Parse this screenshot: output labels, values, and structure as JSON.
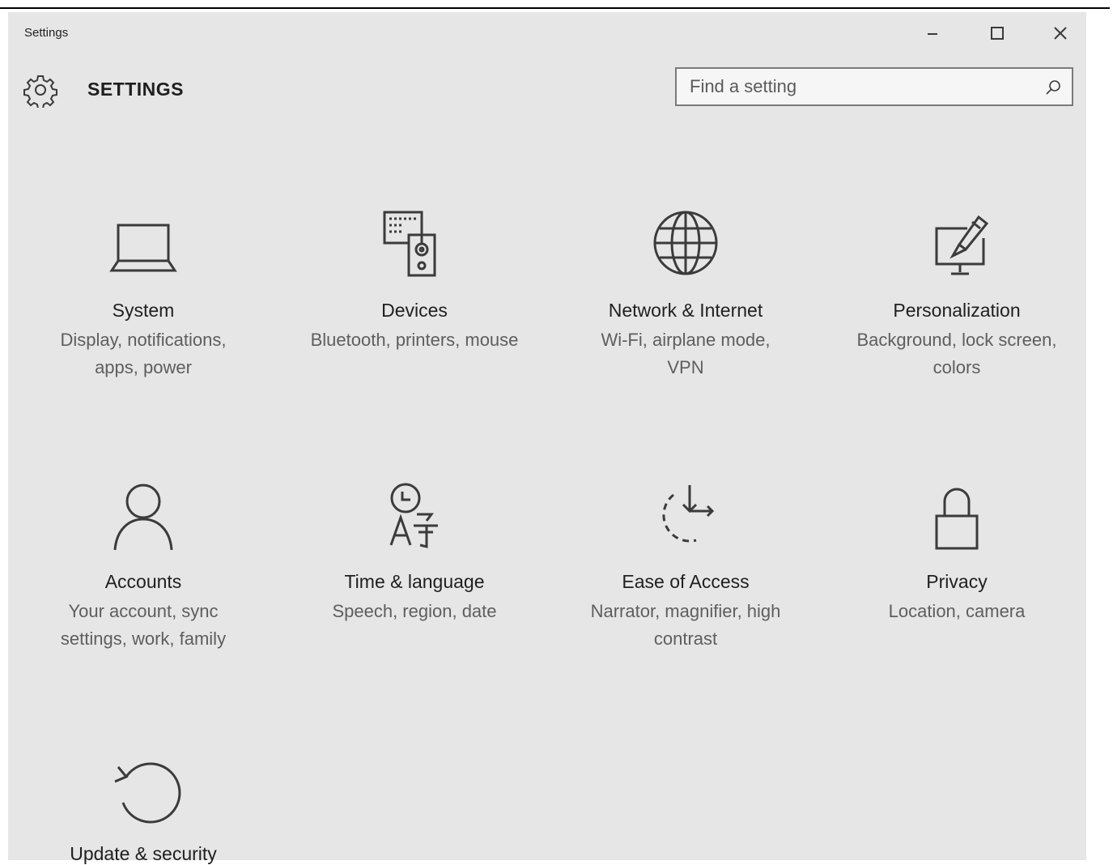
{
  "window": {
    "title": "Settings",
    "controls": {
      "minimize": "–",
      "maximize": "□",
      "close": "✕"
    }
  },
  "header": {
    "app_title": "SETTINGS",
    "search": {
      "placeholder": "Find a setting",
      "value": ""
    },
    "icon": "gear-icon"
  },
  "tiles": [
    {
      "title": "System",
      "desc": "Display, notifications, apps, power",
      "icon": "laptop-icon"
    },
    {
      "title": "Devices",
      "desc": "Bluetooth, printers, mouse",
      "icon": "keyboard-speaker-icon"
    },
    {
      "title": "Network & Internet",
      "desc": "Wi-Fi, airplane mode, VPN",
      "icon": "globe-icon"
    },
    {
      "title": "Personalization",
      "desc": "Background, lock screen, colors",
      "icon": "paintbrush-monitor-icon"
    },
    {
      "title": "Accounts",
      "desc": "Your account, sync settings, work, family",
      "icon": "person-icon"
    },
    {
      "title": "Time & language",
      "desc": "Speech, region, date",
      "icon": "clock-language-icon"
    },
    {
      "title": "Ease of Access",
      "desc": "Narrator, magnifier, high contrast",
      "icon": "ease-of-access-icon"
    },
    {
      "title": "Privacy",
      "desc": "Location, camera",
      "icon": "lock-icon"
    },
    {
      "title": "Update & security",
      "desc": "",
      "icon": "refresh-icon"
    }
  ],
  "colors": {
    "window_bg": "#e6e6e6",
    "text": "#1f1f1f",
    "desc_text": "#5e5e5e"
  }
}
